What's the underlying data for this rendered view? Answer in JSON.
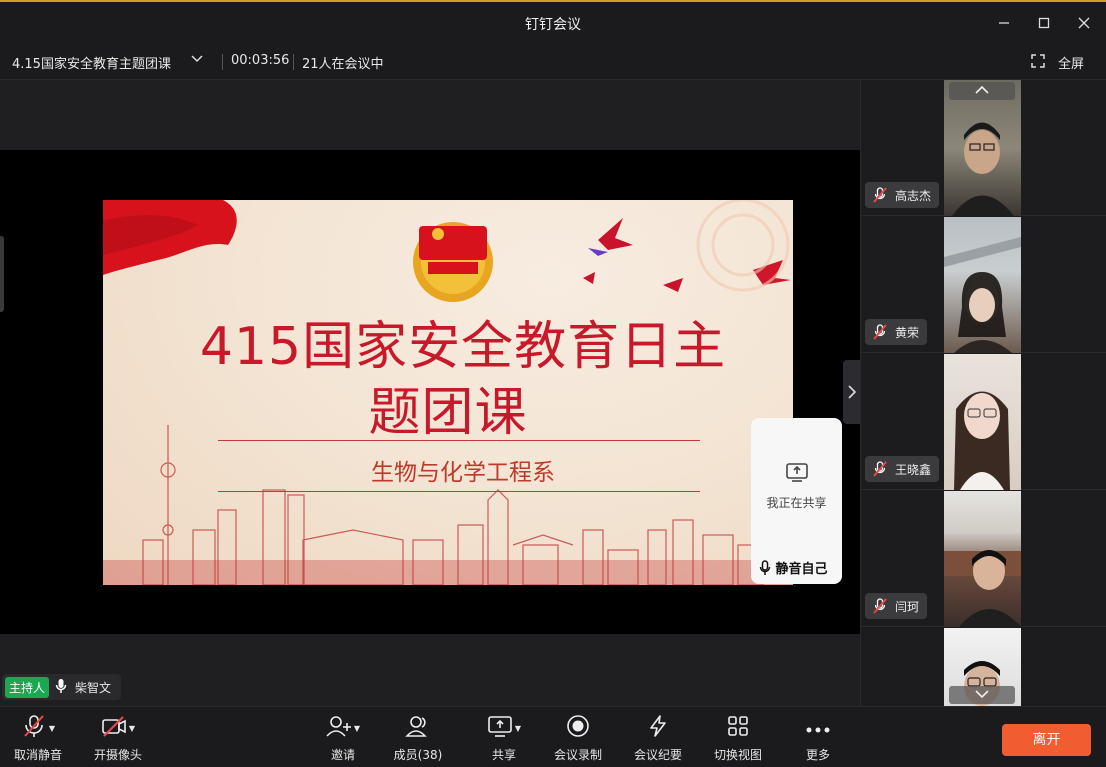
{
  "window": {
    "title": "钉钉会议"
  },
  "info": {
    "meeting_name": "4.15国家安全教育主题团课",
    "timer": "00:03:56",
    "attendance": "21人在会议中",
    "fullscreen_label": "全屏"
  },
  "slide": {
    "title_line1": "415国家安全教育日主",
    "title_line2": "题团课",
    "subtitle": "生物与化学工程系"
  },
  "share_card": {
    "status": "我正在共享",
    "mute_self": "静音自己"
  },
  "host": {
    "badge": "主持人",
    "name": "柴智文"
  },
  "participants": [
    {
      "name": "高志杰"
    },
    {
      "name": "黄荣"
    },
    {
      "name": "王晓鑫"
    },
    {
      "name": "闫珂"
    },
    {
      "name": ""
    }
  ],
  "toolbar": {
    "unmute": "取消静音",
    "camera": "开摄像头",
    "invite": "邀请",
    "members": "成员(38)",
    "share": "共享",
    "record": "会议录制",
    "minutes": "会议纪要",
    "view": "切换视图",
    "more": "更多",
    "leave": "离开"
  },
  "colors": {
    "accent_red": "#c8192a",
    "leave_button": "#f25c31",
    "host_badge": "#1aa852"
  }
}
